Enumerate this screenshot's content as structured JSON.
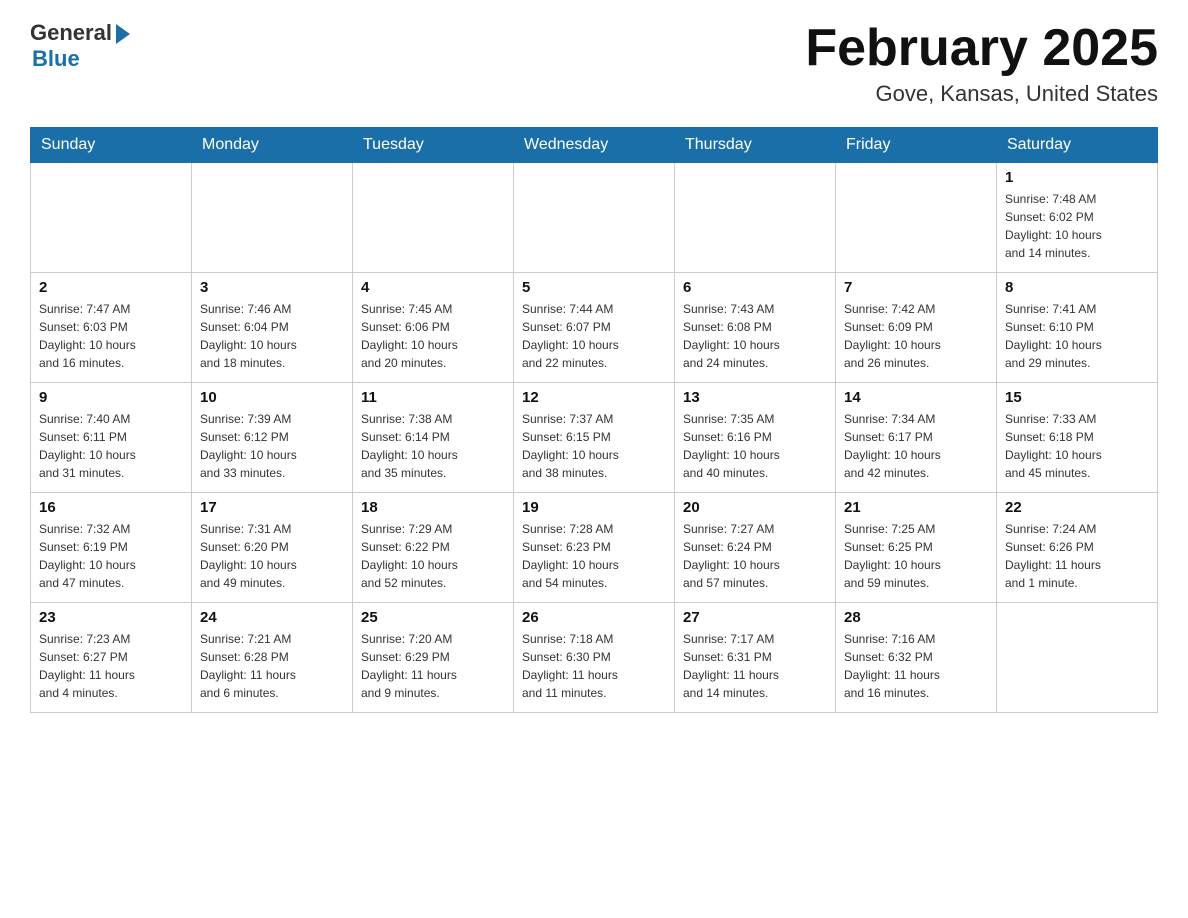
{
  "header": {
    "logo_general": "General",
    "logo_blue": "Blue",
    "month_title": "February 2025",
    "location": "Gove, Kansas, United States"
  },
  "weekdays": [
    "Sunday",
    "Monday",
    "Tuesday",
    "Wednesday",
    "Thursday",
    "Friday",
    "Saturday"
  ],
  "weeks": [
    [
      {
        "day": "",
        "info": ""
      },
      {
        "day": "",
        "info": ""
      },
      {
        "day": "",
        "info": ""
      },
      {
        "day": "",
        "info": ""
      },
      {
        "day": "",
        "info": ""
      },
      {
        "day": "",
        "info": ""
      },
      {
        "day": "1",
        "info": "Sunrise: 7:48 AM\nSunset: 6:02 PM\nDaylight: 10 hours\nand 14 minutes."
      }
    ],
    [
      {
        "day": "2",
        "info": "Sunrise: 7:47 AM\nSunset: 6:03 PM\nDaylight: 10 hours\nand 16 minutes."
      },
      {
        "day": "3",
        "info": "Sunrise: 7:46 AM\nSunset: 6:04 PM\nDaylight: 10 hours\nand 18 minutes."
      },
      {
        "day": "4",
        "info": "Sunrise: 7:45 AM\nSunset: 6:06 PM\nDaylight: 10 hours\nand 20 minutes."
      },
      {
        "day": "5",
        "info": "Sunrise: 7:44 AM\nSunset: 6:07 PM\nDaylight: 10 hours\nand 22 minutes."
      },
      {
        "day": "6",
        "info": "Sunrise: 7:43 AM\nSunset: 6:08 PM\nDaylight: 10 hours\nand 24 minutes."
      },
      {
        "day": "7",
        "info": "Sunrise: 7:42 AM\nSunset: 6:09 PM\nDaylight: 10 hours\nand 26 minutes."
      },
      {
        "day": "8",
        "info": "Sunrise: 7:41 AM\nSunset: 6:10 PM\nDaylight: 10 hours\nand 29 minutes."
      }
    ],
    [
      {
        "day": "9",
        "info": "Sunrise: 7:40 AM\nSunset: 6:11 PM\nDaylight: 10 hours\nand 31 minutes."
      },
      {
        "day": "10",
        "info": "Sunrise: 7:39 AM\nSunset: 6:12 PM\nDaylight: 10 hours\nand 33 minutes."
      },
      {
        "day": "11",
        "info": "Sunrise: 7:38 AM\nSunset: 6:14 PM\nDaylight: 10 hours\nand 35 minutes."
      },
      {
        "day": "12",
        "info": "Sunrise: 7:37 AM\nSunset: 6:15 PM\nDaylight: 10 hours\nand 38 minutes."
      },
      {
        "day": "13",
        "info": "Sunrise: 7:35 AM\nSunset: 6:16 PM\nDaylight: 10 hours\nand 40 minutes."
      },
      {
        "day": "14",
        "info": "Sunrise: 7:34 AM\nSunset: 6:17 PM\nDaylight: 10 hours\nand 42 minutes."
      },
      {
        "day": "15",
        "info": "Sunrise: 7:33 AM\nSunset: 6:18 PM\nDaylight: 10 hours\nand 45 minutes."
      }
    ],
    [
      {
        "day": "16",
        "info": "Sunrise: 7:32 AM\nSunset: 6:19 PM\nDaylight: 10 hours\nand 47 minutes."
      },
      {
        "day": "17",
        "info": "Sunrise: 7:31 AM\nSunset: 6:20 PM\nDaylight: 10 hours\nand 49 minutes."
      },
      {
        "day": "18",
        "info": "Sunrise: 7:29 AM\nSunset: 6:22 PM\nDaylight: 10 hours\nand 52 minutes."
      },
      {
        "day": "19",
        "info": "Sunrise: 7:28 AM\nSunset: 6:23 PM\nDaylight: 10 hours\nand 54 minutes."
      },
      {
        "day": "20",
        "info": "Sunrise: 7:27 AM\nSunset: 6:24 PM\nDaylight: 10 hours\nand 57 minutes."
      },
      {
        "day": "21",
        "info": "Sunrise: 7:25 AM\nSunset: 6:25 PM\nDaylight: 10 hours\nand 59 minutes."
      },
      {
        "day": "22",
        "info": "Sunrise: 7:24 AM\nSunset: 6:26 PM\nDaylight: 11 hours\nand 1 minute."
      }
    ],
    [
      {
        "day": "23",
        "info": "Sunrise: 7:23 AM\nSunset: 6:27 PM\nDaylight: 11 hours\nand 4 minutes."
      },
      {
        "day": "24",
        "info": "Sunrise: 7:21 AM\nSunset: 6:28 PM\nDaylight: 11 hours\nand 6 minutes."
      },
      {
        "day": "25",
        "info": "Sunrise: 7:20 AM\nSunset: 6:29 PM\nDaylight: 11 hours\nand 9 minutes."
      },
      {
        "day": "26",
        "info": "Sunrise: 7:18 AM\nSunset: 6:30 PM\nDaylight: 11 hours\nand 11 minutes."
      },
      {
        "day": "27",
        "info": "Sunrise: 7:17 AM\nSunset: 6:31 PM\nDaylight: 11 hours\nand 14 minutes."
      },
      {
        "day": "28",
        "info": "Sunrise: 7:16 AM\nSunset: 6:32 PM\nDaylight: 11 hours\nand 16 minutes."
      },
      {
        "day": "",
        "info": ""
      }
    ]
  ]
}
